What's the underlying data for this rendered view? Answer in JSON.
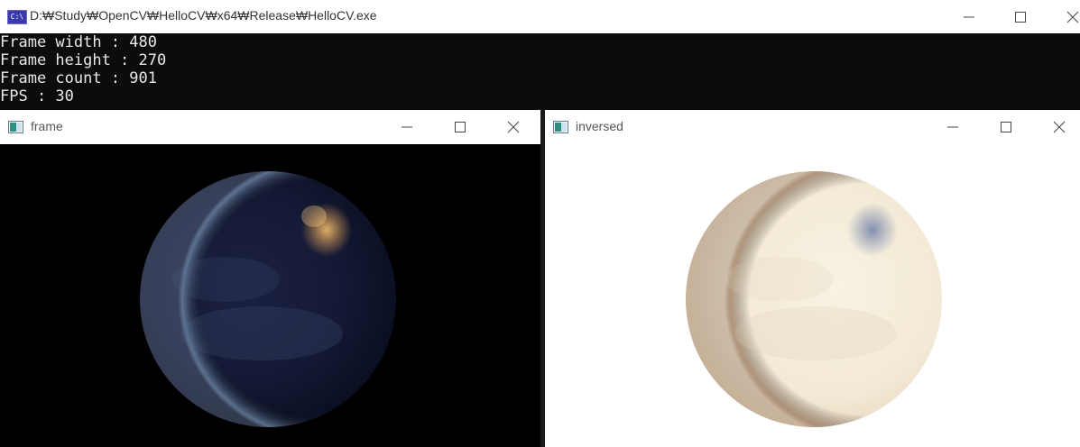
{
  "console": {
    "title": "D:\\Study\\OpenCV\\HelloCV\\x64\\Release\\HelloCV.exe",
    "title_display": "D:₩Study₩OpenCV₩HelloCV₩x64₩Release₩HelloCV.exe",
    "icon": "console-app-icon",
    "icon_text": "C:\\",
    "lines": [
      "Frame width : 480",
      "Frame height : 270",
      "Frame count : 901",
      "FPS : 30"
    ]
  },
  "windows": [
    {
      "title": "frame",
      "icon": "image-window-icon",
      "content": "earth-night-image"
    },
    {
      "title": "inversed",
      "icon": "image-window-icon",
      "content": "earth-inverted-image"
    }
  ],
  "controls": {
    "minimize": "minimize-icon",
    "maximize": "maximize-icon",
    "close": "close-icon"
  },
  "colors": {
    "console_bg": "#0c0c0c",
    "titlebar_bg": "#ffffff",
    "console_text": "#e8e8e8"
  }
}
